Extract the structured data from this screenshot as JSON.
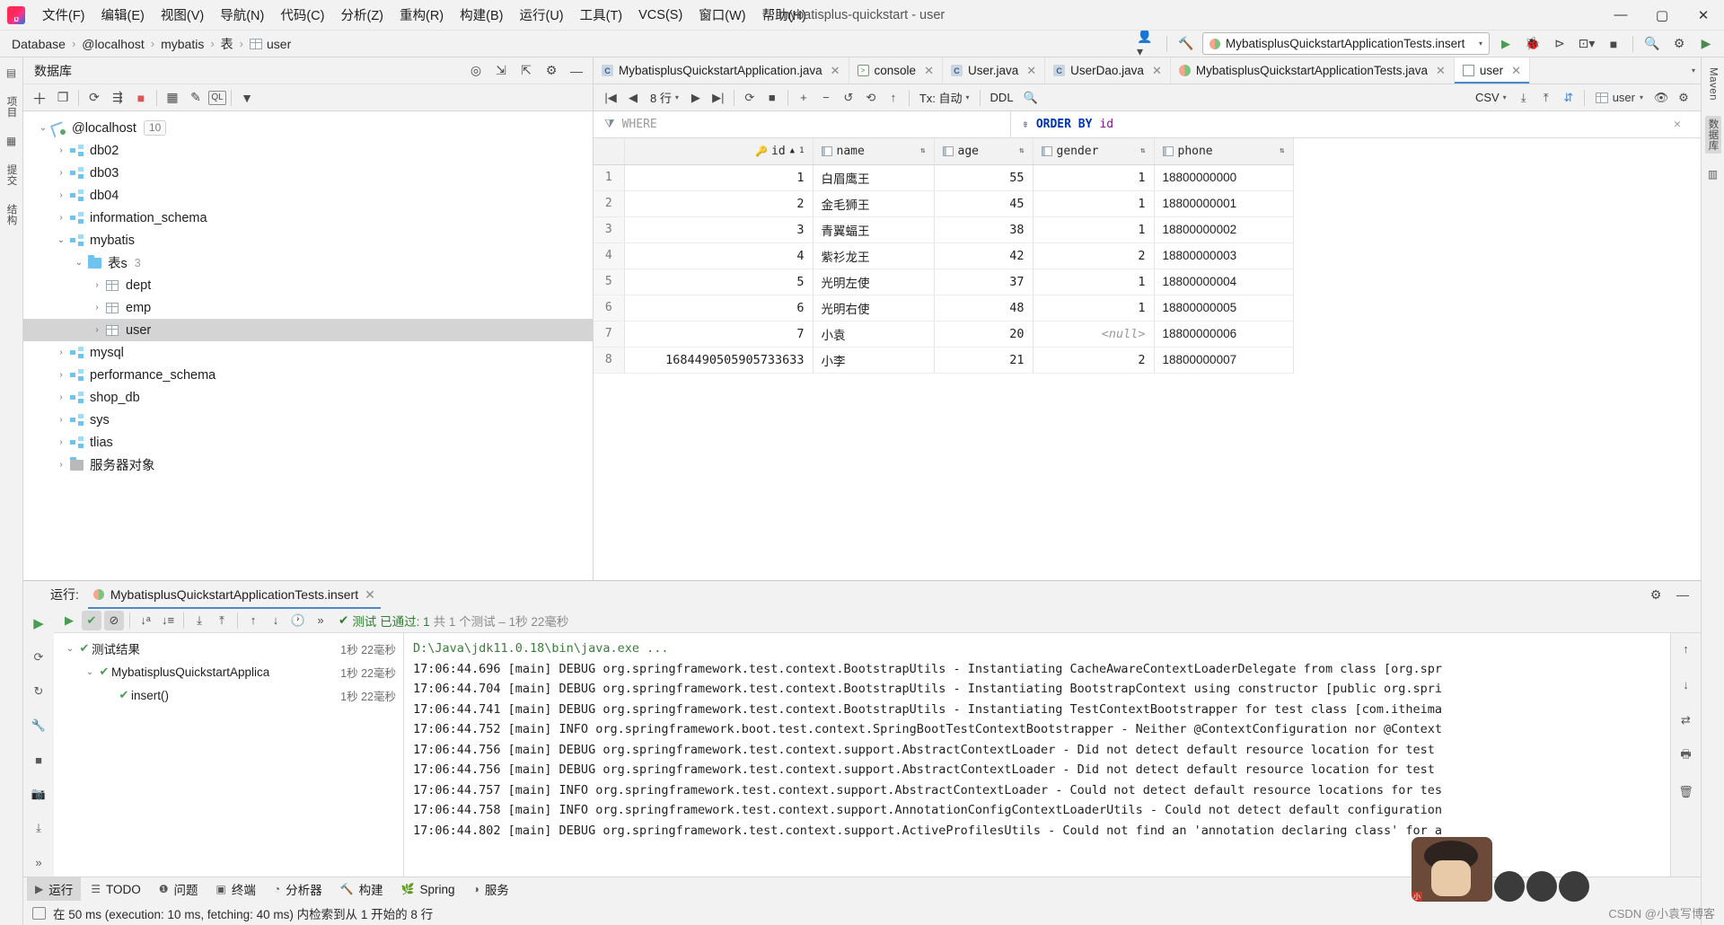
{
  "titlebar": {
    "logo": "intellij-logo",
    "menu": [
      "文件(F)",
      "编辑(E)",
      "视图(V)",
      "导航(N)",
      "代码(C)",
      "分析(Z)",
      "重构(R)",
      "构建(B)",
      "运行(U)",
      "工具(T)",
      "VCS(S)",
      "窗口(W)",
      "帮助(H)"
    ],
    "window_title": "mybatisplus-quickstart - user",
    "minimize": "—",
    "maximize": "▢",
    "close": "✕"
  },
  "navbar": {
    "crumbs": [
      "Database",
      "@localhost",
      "mybatis",
      "表",
      "user"
    ],
    "separator": "›",
    "run_config": "MybatisplusQuickstartApplicationTests.insert",
    "run_caret": "▾",
    "icons": {
      "user_settings": "user-icon",
      "build": "hammer-icon",
      "run": "▶",
      "debug": "debug-icon",
      "run_with_coverage": "coverage-icon",
      "more": "▾",
      "stop": "■",
      "search": "search-icon",
      "settings": "gear-icon",
      "updates": "update-icon"
    }
  },
  "left_strip": {
    "items": [
      "项目",
      "提交",
      "结构"
    ]
  },
  "right_strip": {
    "items": [
      "Maven",
      "数据库",
      "通知"
    ]
  },
  "db_panel": {
    "title": "数据库",
    "header_icons": [
      "target-icon",
      "collapse-icon",
      "expand-icon",
      "gear-icon",
      "minimize-icon"
    ],
    "toolbar_icons": [
      "add-icon",
      "duplicate-icon",
      "refresh-icon",
      "sync-icon",
      "stop-icon",
      "table-icon",
      "edit-icon",
      "query-icon",
      "filter-icon"
    ],
    "tree": [
      {
        "label": "@localhost",
        "level": 0,
        "arrow": "open",
        "icon": "connection-icon",
        "badge": "10",
        "selected": false
      },
      {
        "label": "db02",
        "level": 1,
        "arrow": "closed",
        "icon": "schema-icon",
        "selected": false
      },
      {
        "label": "db03",
        "level": 1,
        "arrow": "closed",
        "icon": "schema-icon",
        "selected": false
      },
      {
        "label": "db04",
        "level": 1,
        "arrow": "closed",
        "icon": "schema-icon",
        "selected": false
      },
      {
        "label": "information_schema",
        "level": 1,
        "arrow": "closed",
        "icon": "schema-icon",
        "selected": false
      },
      {
        "label": "mybatis",
        "level": 1,
        "arrow": "open",
        "icon": "schema-icon",
        "selected": false
      },
      {
        "label": "表s",
        "level": 2,
        "arrow": "open",
        "icon": "folder-icon",
        "count": "3",
        "selected": false
      },
      {
        "label": "dept",
        "level": 3,
        "arrow": "closed",
        "icon": "table-icon",
        "selected": false
      },
      {
        "label": "emp",
        "level": 3,
        "arrow": "closed",
        "icon": "table-icon",
        "selected": false
      },
      {
        "label": "user",
        "level": 3,
        "arrow": "closed",
        "icon": "table-icon",
        "selected": true
      },
      {
        "label": "mysql",
        "level": 1,
        "arrow": "closed",
        "icon": "schema-icon",
        "selected": false
      },
      {
        "label": "performance_schema",
        "level": 1,
        "arrow": "closed",
        "icon": "schema-icon",
        "selected": false
      },
      {
        "label": "shop_db",
        "level": 1,
        "arrow": "closed",
        "icon": "schema-icon",
        "selected": false
      },
      {
        "label": "sys",
        "level": 1,
        "arrow": "closed",
        "icon": "schema-icon",
        "selected": false
      },
      {
        "label": "tlias",
        "level": 1,
        "arrow": "closed",
        "icon": "schema-icon",
        "selected": false
      },
      {
        "label": "服务器对象",
        "level": 1,
        "arrow": "closed",
        "icon": "folder-gray-icon",
        "selected": false
      }
    ]
  },
  "editor": {
    "tabs": [
      {
        "label": "MybatisplusQuickstartApplication.java",
        "icon": "java-icon",
        "active": false,
        "closable": true
      },
      {
        "label": "console",
        "icon": "console-icon",
        "active": false,
        "closable": true
      },
      {
        "label": "User.java",
        "icon": "java-icon",
        "active": false,
        "closable": true
      },
      {
        "label": "UserDao.java",
        "icon": "java-icon",
        "active": false,
        "closable": true
      },
      {
        "label": "MybatisplusQuickstartApplicationTests.java",
        "icon": "test-icon",
        "active": false,
        "closable": true
      },
      {
        "label": "user",
        "icon": "grid-icon",
        "active": true,
        "closable": true
      }
    ],
    "tab_overflow": "▾"
  },
  "grid_toolbar": {
    "first_page": "|◀",
    "prev_page": "◀",
    "rows_label": "8 行",
    "rows_caret": "▾",
    "next_page": "▶",
    "last_page": "▶|",
    "refresh": "⟳",
    "stop": "■",
    "add_row": "+",
    "delete_row": "−",
    "revert": "↺",
    "rollback": "⟲",
    "submit": "↑",
    "tx_label": "Tx: 自动",
    "tx_caret": "▾",
    "ddl": "DDL",
    "search": "search-icon",
    "export_format": "CSV",
    "export_caret": "▾",
    "download": "⤓",
    "upload": "⤒",
    "sync": "⇄",
    "user_value": "user",
    "user_caret": "▾",
    "preview": "eye-icon",
    "settings": "gear-icon"
  },
  "filters": {
    "where_icon": "filter-icon",
    "where_placeholder": "WHERE",
    "order_icon": "sort-icon",
    "order_kw": "ORDER BY",
    "order_col": "id",
    "close": "✕"
  },
  "table_data": {
    "columns": [
      {
        "name": "id",
        "align": "right",
        "icon": "key-icon",
        "sort": "▲",
        "sort_order": "1"
      },
      {
        "name": "name",
        "align": "left",
        "icon": "column-icon",
        "sort": "⇅"
      },
      {
        "name": "age",
        "align": "right",
        "icon": "column-icon",
        "sort": "⇅"
      },
      {
        "name": "gender",
        "align": "right",
        "icon": "column-icon",
        "sort": "⇅"
      },
      {
        "name": "phone",
        "align": "left",
        "icon": "column-icon",
        "sort": "⇅"
      }
    ],
    "rows": [
      {
        "n": "1",
        "id": "1",
        "name": "白眉鹰王",
        "age": "55",
        "gender": "1",
        "phone": "18800000000"
      },
      {
        "n": "2",
        "id": "2",
        "name": "金毛狮王",
        "age": "45",
        "gender": "1",
        "phone": "18800000001"
      },
      {
        "n": "3",
        "id": "3",
        "name": "青翼蝠王",
        "age": "38",
        "gender": "1",
        "phone": "18800000002"
      },
      {
        "n": "4",
        "id": "4",
        "name": "紫衫龙王",
        "age": "42",
        "gender": "2",
        "phone": "18800000003"
      },
      {
        "n": "5",
        "id": "5",
        "name": "光明左使",
        "age": "37",
        "gender": "1",
        "phone": "18800000004"
      },
      {
        "n": "6",
        "id": "6",
        "name": "光明右使",
        "age": "48",
        "gender": "1",
        "phone": "18800000005"
      },
      {
        "n": "7",
        "id": "7",
        "name": "小袁",
        "age": "20",
        "gender": "<null>",
        "phone": "18800000006"
      },
      {
        "n": "8",
        "id": "1684490505905733633",
        "name": "小李",
        "age": "21",
        "gender": "2",
        "phone": "18800000007"
      }
    ]
  },
  "run_panel": {
    "label": "运行:",
    "tab": "MybatisplusQuickstartApplicationTests.insert",
    "tab_close": "✕",
    "settings_icon": "gear-icon",
    "minimize_icon": "minimize-icon",
    "gutter_icons": [
      "run-icon",
      "rerun-icon",
      "rerun-failed-icon",
      "wrench-icon",
      "stop-icon",
      "camera-icon",
      "export-icon",
      "more-icon"
    ],
    "toolbar_icons": [
      "run-icon",
      "show-passed-icon",
      "ignore-icon",
      "sort-alpha-icon",
      "sort-duration-icon",
      "expand-all-icon",
      "collapse-all-icon",
      "prev-icon",
      "next-icon",
      "history-icon",
      "more-icon"
    ],
    "status_check": "✔",
    "status_text_1": "测试 已通过: 1",
    "status_text_2": "共 1 个测试 – 1秒 22毫秒",
    "tree": [
      {
        "label": "测试结果",
        "time": "1秒 22毫秒",
        "level": 0,
        "arrow": "open",
        "check": "✔"
      },
      {
        "label": "MybatisplusQuickstartApplica",
        "time": "1秒 22毫秒",
        "level": 1,
        "arrow": "open",
        "check": "✔"
      },
      {
        "label": "insert()",
        "time": "1秒 22毫秒",
        "level": 2,
        "arrow": "none",
        "check": "✔"
      }
    ],
    "console_lines": [
      {
        "text": "D:\\Java\\jdk11.0.18\\bin\\java.exe ...",
        "type": "cmd"
      },
      {
        "text": "17:06:44.696 [main] DEBUG org.springframework.test.context.BootstrapUtils - Instantiating CacheAwareContextLoaderDelegate from class [org.spr",
        "type": "log"
      },
      {
        "text": "17:06:44.704 [main] DEBUG org.springframework.test.context.BootstrapUtils - Instantiating BootstrapContext using constructor [public org.spri",
        "type": "log"
      },
      {
        "text": "17:06:44.741 [main] DEBUG org.springframework.test.context.BootstrapUtils - Instantiating TestContextBootstrapper for test class [com.itheima",
        "type": "log"
      },
      {
        "text": "17:06:44.752 [main] INFO org.springframework.boot.test.context.SpringBootTestContextBootstrapper - Neither @ContextConfiguration nor @Context",
        "type": "log"
      },
      {
        "text": "17:06:44.756 [main] DEBUG org.springframework.test.context.support.AbstractContextLoader - Did not detect default resource location for test",
        "type": "log"
      },
      {
        "text": "17:06:44.756 [main] DEBUG org.springframework.test.context.support.AbstractContextLoader - Did not detect default resource location for test",
        "type": "log"
      },
      {
        "text": "17:06:44.757 [main] INFO org.springframework.test.context.support.AbstractContextLoader - Could not detect default resource locations for tes",
        "type": "log"
      },
      {
        "text": "17:06:44.758 [main] INFO org.springframework.test.context.support.AnnotationConfigContextLoaderUtils - Could not detect default configuration",
        "type": "log"
      },
      {
        "text": "17:06:44.802 [main] DEBUG org.springframework.test.context.support.ActiveProfilesUtils - Could not find an 'annotation declaring class' for a",
        "type": "log"
      }
    ],
    "console_gutter_icons": [
      "up-icon",
      "down-icon",
      "wrap-icon",
      "print-icon",
      "trash-icon"
    ]
  },
  "bottom_toolbar": {
    "items": [
      {
        "label": "运行",
        "icon": "run-icon",
        "active": true
      },
      {
        "label": "TODO",
        "icon": "todo-icon",
        "active": false
      },
      {
        "label": "问题",
        "icon": "problems-icon",
        "active": false
      },
      {
        "label": "终端",
        "icon": "terminal-icon",
        "active": false
      },
      {
        "label": "分析器",
        "icon": "profiler-icon",
        "active": false
      },
      {
        "label": "构建",
        "icon": "build-icon",
        "active": false
      },
      {
        "label": "Spring",
        "icon": "spring-icon",
        "active": false
      },
      {
        "label": "服务",
        "icon": "services-icon",
        "active": false
      }
    ]
  },
  "statusbar": {
    "icon": "console-icon",
    "text": "在 50 ms (execution: 10 ms, fetching: 40 ms) 内检索到从 1 开始的 8 行"
  },
  "watermark": "CSDN @小袁写博客"
}
